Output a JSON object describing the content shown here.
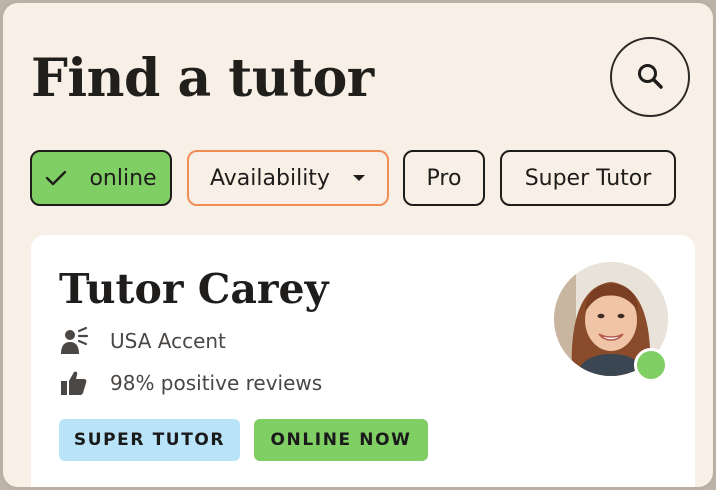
{
  "header": {
    "title": "Find a tutor",
    "search_icon": "search-icon"
  },
  "filters": {
    "online": {
      "label": "online",
      "icon": "check-icon",
      "selected": true
    },
    "availability": {
      "label": "Availability",
      "icon": "caret-down-icon"
    },
    "pro": {
      "label": "Pro"
    },
    "super_tutor": {
      "label": "Super Tutor"
    }
  },
  "tutor_card": {
    "name": "Tutor Carey",
    "accent": {
      "icon": "speaking-person-icon",
      "text": "USA Accent"
    },
    "reviews": {
      "icon": "thumbs-up-icon",
      "text": "98% positive reviews"
    },
    "badges": [
      {
        "label": "SUPER TUTOR",
        "color": "#b8e3f8"
      },
      {
        "label": "ONLINE NOW",
        "color": "#7fcf64"
      }
    ],
    "status": "online"
  },
  "colors": {
    "background": "#f8f0e6",
    "accent_green": "#7fcf64",
    "accent_orange": "#f08d55",
    "badge_blue": "#b8e3f8",
    "text_dark": "#1f1d1b"
  }
}
